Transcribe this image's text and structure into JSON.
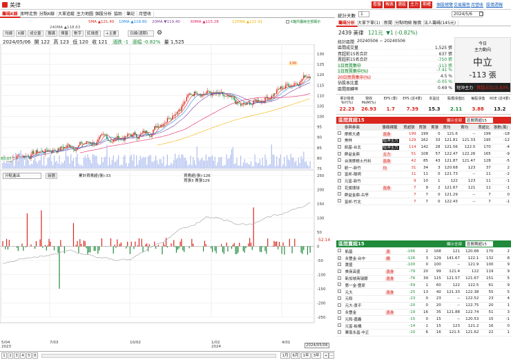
{
  "window": {
    "title": "美律"
  },
  "topbar": {
    "red_buttons": [
      "看盤",
      "報表",
      "選股",
      "主力",
      "期權"
    ],
    "links": [
      "個股總覽",
      "交易屬性",
      "月營收",
      "股價週報"
    ]
  },
  "tabs": [
    "籌碼K線",
    "即時走勢",
    "分點K線",
    "大單追蹤",
    "主力地圖",
    "個股分析",
    "協助",
    "筆記",
    "月營收"
  ],
  "ma": {
    "row1": [
      {
        "label": "5MA ▲121.40",
        "color": "#d9251d"
      },
      {
        "label": "10MA ▲118.80",
        "color": "#1e88e5"
      },
      {
        "label": "20MA ▼119.40",
        "color": "#7b3fa0"
      },
      {
        "label": "60MA ▲115.28",
        "color": "#e91e63"
      },
      {
        "label": "120MA ▲111.91",
        "color": "#f0b400"
      }
    ],
    "row2": [
      {
        "label": "240MA ▲118.63",
        "color": "#555"
      }
    ],
    "toggle": "K軸所屬線全部顯示"
  },
  "toolbar": {
    "items": [
      "均線",
      "K線",
      "成交量",
      "籌碼",
      "揮量",
      "數字",
      "紅綠燈",
      "+主要",
      "日線(週期)"
    ],
    "gear": "⚙"
  },
  "quote_line": {
    "date": "2024/05/06",
    "open": "開 122",
    "high": "高 123",
    "low": "低 120",
    "close": "收 121",
    "change": "漲跌 -1",
    "pct": "漲幅 -0.82%",
    "vol": "量 1,525"
  },
  "chart": {
    "price_ticks": [
      "130",
      "125",
      "120",
      "115",
      "110",
      "105",
      "100",
      "95",
      "90",
      "85",
      "80",
      "75"
    ],
    "marker_high": "130",
    "marker_low": "80.07",
    "lower_selector": "分點進出",
    "lower_btn": "繪圖",
    "lower_legend": {
      "line1": "累計買賣超(張)-33",
      "line2a": "買賣超(張)-126",
      "line2b": "買張3 賣張129"
    },
    "lower_ticks": [
      "250",
      "200",
      "150",
      "100",
      "50",
      "0",
      "-50",
      "-100",
      "-150",
      "-200",
      "-250"
    ],
    "current_value": "52.14",
    "x_ticks": [
      {
        "label": "5/04",
        "sub": "2023"
      },
      {
        "label": "7/03",
        "sub": ""
      },
      {
        "label": "10/02",
        "sub": ""
      },
      {
        "label": "1/02",
        "sub": "2024"
      },
      {
        "label": "4/01",
        "sub": ""
      }
    ],
    "x_current": "2024/05/06"
  },
  "bottom": {
    "pages": [
      "1",
      "2",
      "3",
      "4",
      "5",
      "6"
    ],
    "ranges": [
      "1月",
      "6月",
      "1年",
      "3年"
    ]
  },
  "right": {
    "stat_label": "統計天數",
    "stat_value": "1",
    "date": "2024/5/6",
    "subtabs": [
      "籌碼分析",
      "大單下單(1)",
      "新聞",
      "分點明細",
      "報價",
      "法人籌碼(145元)"
    ],
    "stock": {
      "code": "2439 美律",
      "price": "121元",
      "change": "▼1 (-0.82%)"
    },
    "summary": {
      "range_label": "統計區間",
      "range": "20240506 ~ 20240506",
      "rows": [
        {
          "k": "區間成交量",
          "v": "1,525 張"
        },
        {
          "k": "買超前15名合計",
          "v": "637 張"
        },
        {
          "k": "賣超前15名合計",
          "v": "-750 張"
        },
        {
          "k": "1日買賣集中",
          "v": "-113 張"
        },
        {
          "k": "1日買賣集中(%)",
          "v": "-7.41 %"
        },
        {
          "k": "20日買賣集中(%)",
          "v": "4.5 %"
        },
        {
          "k": "佔股本比重",
          "v": "-0.05 %"
        },
        {
          "k": "區間周轉率",
          "v": "0.69 %"
        }
      ],
      "today_label": "今日",
      "main_force_label": "主力動向",
      "verdict": "中立",
      "verdict_value": "-113 張",
      "short_term": "短沖主力",
      "short_pct": "買超占比15.93%"
    },
    "metrics": {
      "headers": [
        "累計營收 YoY(%)",
        "營收 MoM(%)",
        "EPS (季)",
        "EPS (近4季)",
        "本益比",
        "股價淨值比",
        "每股淨值",
        "ROE (近4季)"
      ],
      "values": [
        "22.23",
        "26.93",
        "1.7",
        "7.39",
        "15.3",
        "2.11",
        "3.88",
        "13.2"
      ],
      "colors": [
        "#d9251d",
        "#d9251d",
        "#d9251d",
        "#d9251d",
        "#222",
        "#1e8a3a",
        "#d9251d",
        "#222"
      ]
    },
    "buy_table": {
      "title": "區間買超15",
      "filter": "顯示全部",
      "filter_sel": "區間買超15",
      "headers": [
        "",
        "參與券商",
        "籌碼標籤",
        "買超張",
        "買張",
        "賣張",
        "買均",
        "賣均",
        "買超比",
        "張數(萬)"
      ],
      "rows": [
        [
          "",
          "摩根大通",
          "混身",
          "199",
          "199",
          "0",
          "121.6",
          "--",
          "199",
          "-18"
        ],
        [
          "",
          "美林",
          "短沖主力",
          "129",
          "162",
          "33",
          "121.81",
          "121.33",
          "195",
          "-12"
        ],
        [
          "",
          "凱基-台北",
          "短沖主力",
          "114",
          "142",
          "28",
          "121.56",
          "122.5",
          "170",
          "-4"
        ],
        [
          "",
          "群益金鼎",
          "主力",
          "51",
          "108",
          "57",
          "122.47",
          "122.26",
          "165",
          "-9"
        ],
        [
          "",
          "台灣摩根士丹利",
          "混身",
          "42",
          "85",
          "43",
          "121.87",
          "121.47",
          "128",
          "-5"
        ],
        [
          "",
          "統一-新竹",
          "均",
          "31",
          "34",
          "3",
          "120.68",
          "123",
          "37",
          "2"
        ],
        [
          "",
          "富邦-陽明",
          "",
          "11",
          "11",
          "0",
          "121.73",
          "--",
          "11",
          "-2"
        ],
        [
          "",
          "元富-新竹",
          "",
          "9",
          "10",
          "1",
          "122",
          "123",
          "11",
          "-1"
        ],
        [
          "",
          "花旗環球",
          "混身",
          "7",
          "9",
          "2",
          "121.67",
          "121",
          "11",
          "-1"
        ],
        [
          "",
          "群益金鼎-古亭",
          "",
          "7",
          "7",
          "0",
          "121.29",
          "--",
          "7",
          "0"
        ],
        [
          "",
          "富邦-竹北",
          "",
          "7",
          "7",
          "0",
          "122.43",
          "--",
          "7",
          "-1"
        ]
      ]
    },
    "sell_table": {
      "title": "區間賣超15",
      "filter": "顯示全部",
      "filter_sel": "區間賣超15",
      "rows": [
        [
          "",
          "凱基",
          "混",
          "-166",
          "2",
          "168",
          "121",
          "120.68",
          "170",
          "2"
        ],
        [
          "✓",
          "永豐金-台中",
          "鑽",
          "-126",
          "3",
          "129",
          "141.67",
          "122.1",
          "132",
          "8"
        ],
        [
          "",
          "寶盛",
          "",
          "-100",
          "0",
          "100",
          "--",
          "121.9",
          "100",
          "9"
        ],
        [
          "",
          "美商高盛",
          "混身",
          "-79",
          "20",
          "99",
          "121.4",
          "122",
          "119",
          "9"
        ],
        [
          "",
          "新加坡商瑞銀",
          "混身",
          "-76",
          "39",
          "115",
          "121.57",
          "121.67",
          "151",
          "5"
        ],
        [
          "",
          "第一金-豐原",
          "",
          "-59",
          "1",
          "60",
          "122",
          "122.5",
          "61",
          "9"
        ],
        [
          "",
          "元大",
          "混身",
          "-25",
          "13",
          "40",
          "121.33",
          "122.38",
          "55",
          "5"
        ],
        [
          "",
          "元和",
          "",
          "-23",
          "0",
          "23",
          "--",
          "122.52",
          "23",
          "4"
        ],
        [
          "",
          "元大-景平",
          "",
          "-20",
          "0",
          "20",
          "--",
          "122.75",
          "20",
          "1"
        ],
        [
          "",
          "永豐金",
          "混身",
          "-19",
          "16",
          "35",
          "121.88",
          "122.74",
          "51",
          "3"
        ],
        [
          "",
          "元和-嘉義",
          "",
          "-15",
          "0",
          "15",
          "--",
          "120.53",
          "15",
          "-1"
        ],
        [
          "",
          "元富-板橋",
          "",
          "-14",
          "1",
          "15",
          "123",
          "121.2",
          "16",
          "0"
        ],
        [
          "",
          "華南永昌-中正",
          "",
          "-10",
          "6",
          "16",
          "121.5",
          "121.62",
          "22",
          "1"
        ]
      ]
    }
  }
}
